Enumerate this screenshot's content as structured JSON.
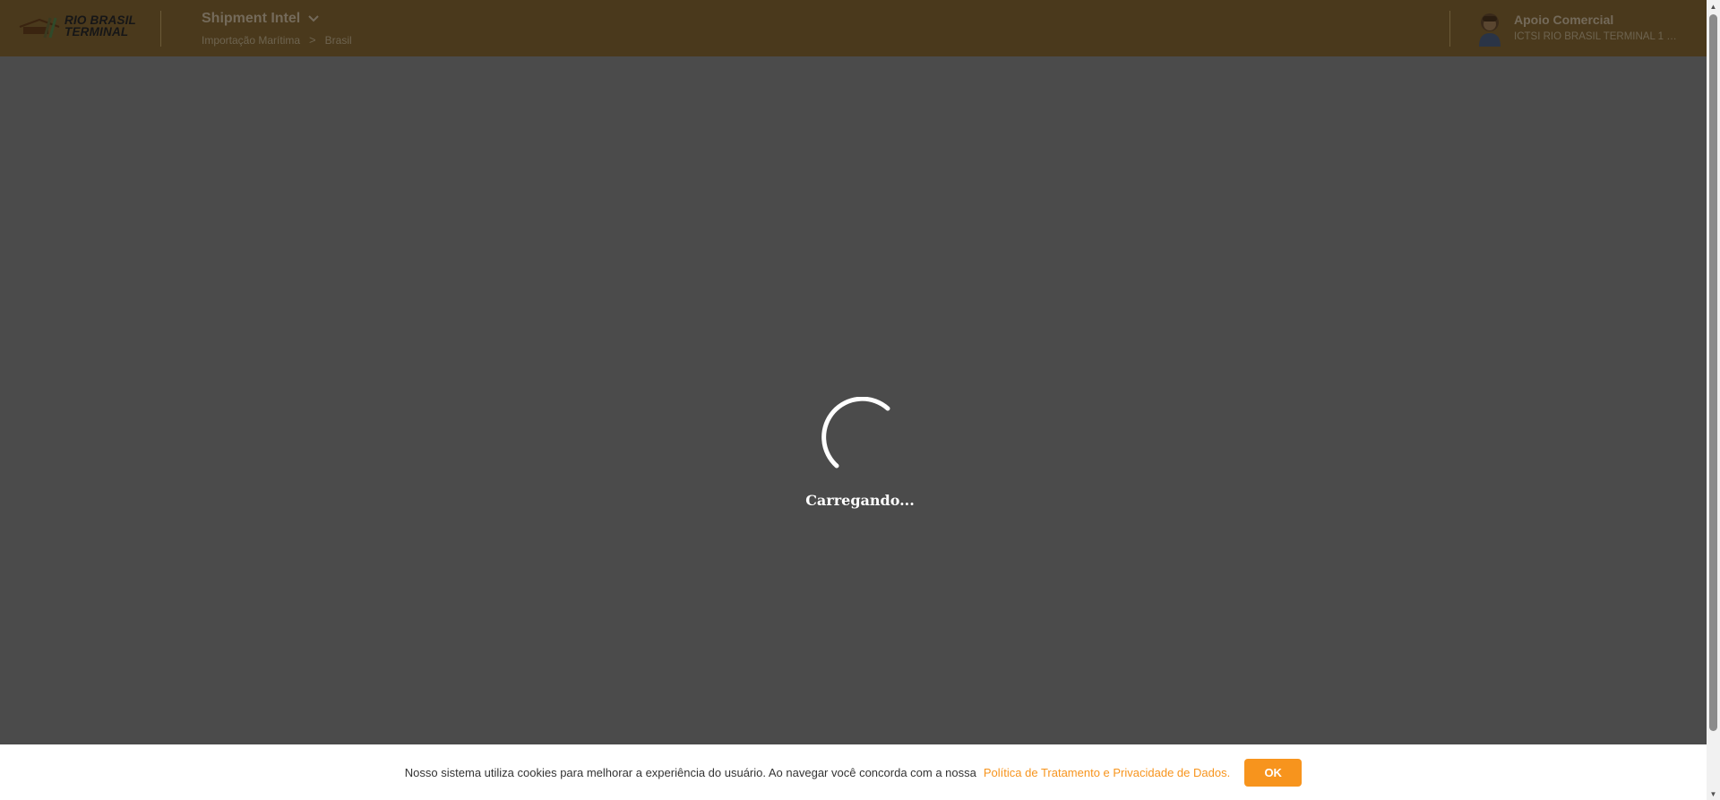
{
  "header": {
    "logo_text_line1": "RIO BRASIL",
    "logo_text_line2": "TERMINAL",
    "app_title": "Shipment Intel",
    "breadcrumb": [
      "Importação Marítima",
      "Brasil"
    ],
    "breadcrumb_separator": ">",
    "user": {
      "name": "Apoio Comercial",
      "company": "ICTSI RIO BRASIL TERMINAL 1 S..."
    }
  },
  "loading": {
    "text": "Carregando..."
  },
  "cookie_bar": {
    "message": "Nosso sistema utiliza cookies para melhorar a experiência do usuário. Ao navegar você concorda com a nossa",
    "link_text": "Política de Tratamento e Privacidade de Dados.",
    "ok_label": "OK"
  },
  "colors": {
    "accent": "#f7941d",
    "header_dimmed": "#4a391c",
    "overlay": "#4b4b4b"
  },
  "icons": {
    "app_switch": "chevron-down-icon",
    "avatar": "user-avatar-icon",
    "spinner": "loading-spinner-icon"
  }
}
